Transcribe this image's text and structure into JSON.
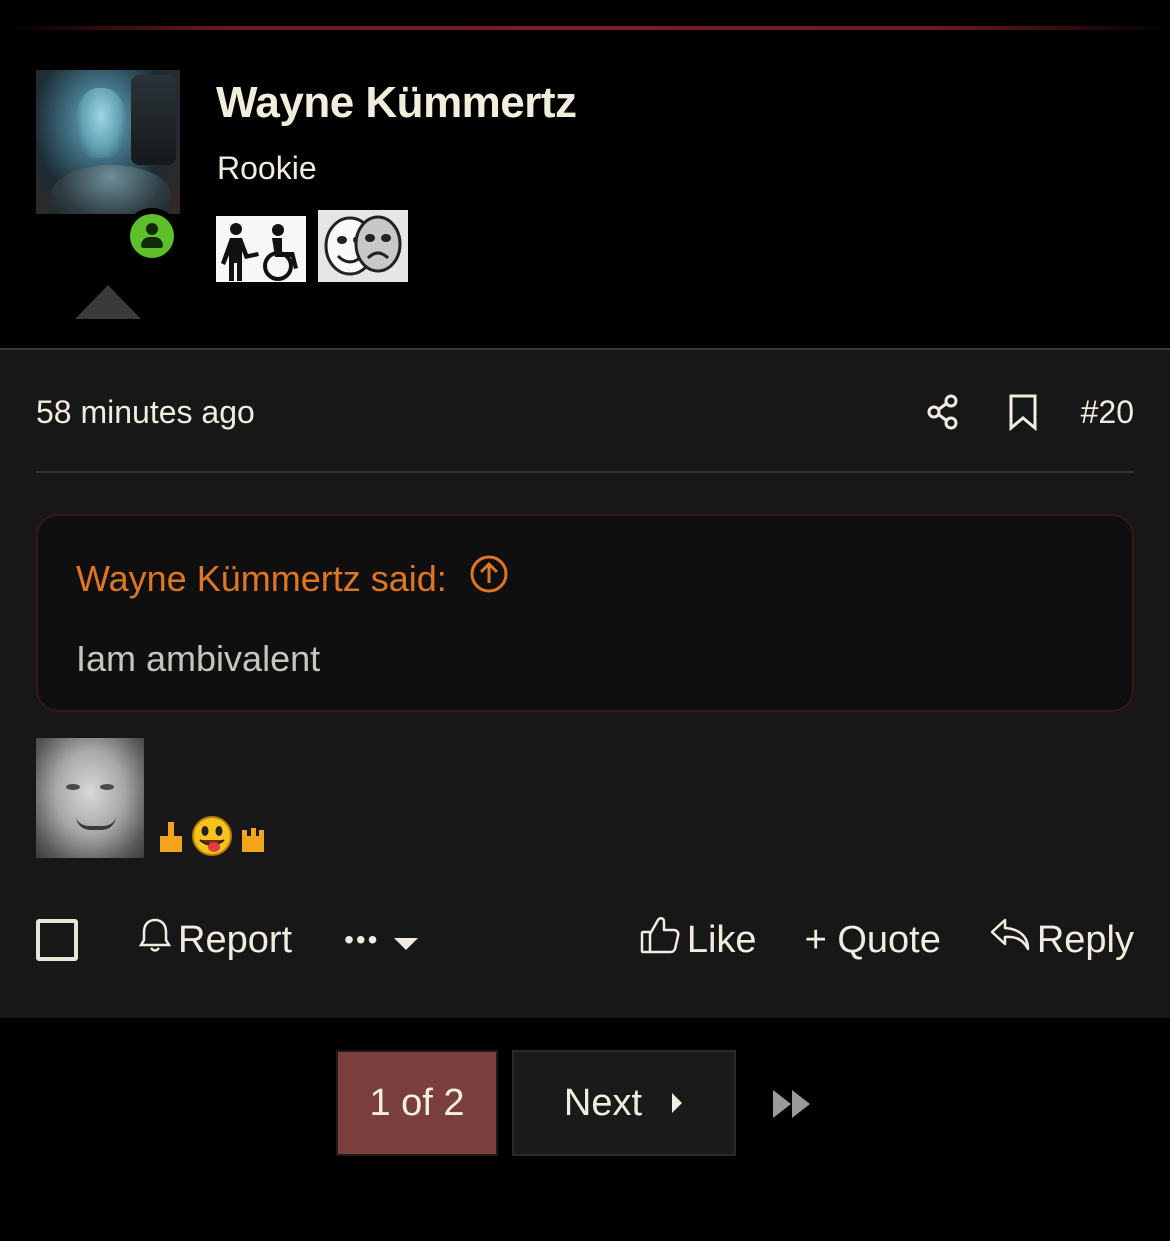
{
  "user": {
    "name": "Wayne Kümmertz",
    "title": "Rookie",
    "status": "online",
    "trophies": [
      "assist-icon",
      "theatre-masks-icon"
    ]
  },
  "post": {
    "timestamp": "58 minutes ago",
    "number": "#20",
    "quote": {
      "author_said": "Wayne Kümmertz said:",
      "text": "Iam ambivalent"
    },
    "reaction_emoji": "middle-finger-tongue-emoji"
  },
  "actions": {
    "report": "Report",
    "more": "•••",
    "like": "Like",
    "quote": "+ Quote",
    "reply": "Reply"
  },
  "pagination": {
    "current": "1 of 2",
    "next": "Next"
  },
  "colors": {
    "accent_quote": "#e0761f",
    "page_current_bg": "#7a3f3d",
    "online": "#5fbf2a",
    "post_bg": "#171717"
  }
}
